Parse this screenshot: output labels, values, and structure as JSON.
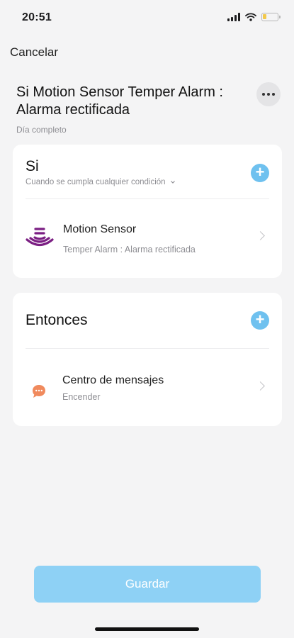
{
  "status_bar": {
    "time": "20:51",
    "icons": [
      "signal-icon",
      "wifi-icon",
      "battery-icon"
    ],
    "battery_level": 0.25,
    "battery_color": "#f2c94c"
  },
  "header": {
    "cancel_label": "Cancelar",
    "title": "Si Motion Sensor  Temper Alarm : Alarma rectificada",
    "schedule": "Día completo",
    "more_icon": "more-horizontal-icon"
  },
  "if_section": {
    "title": "Si",
    "condition_selector": "Cuando se cumpla cualquier condición",
    "add_icon": "plus-icon",
    "conditions": [
      {
        "icon": "motion-sensor-icon",
        "name": "Motion Sensor",
        "detail": "Temper Alarm : Alarma rectificada"
      }
    ]
  },
  "then_section": {
    "title": "Entonces",
    "add_icon": "plus-icon",
    "actions": [
      {
        "icon": "message-icon",
        "name": "Centro de mensajes",
        "detail": "Encender"
      }
    ]
  },
  "footer": {
    "save_label": "Guardar"
  },
  "colors": {
    "accent": "#6fc1ef",
    "save_button": "#8ed1f5",
    "sensor_icon": "#7b1f83",
    "message_icon": "#f08a5d",
    "background": "#f4f4f5"
  }
}
